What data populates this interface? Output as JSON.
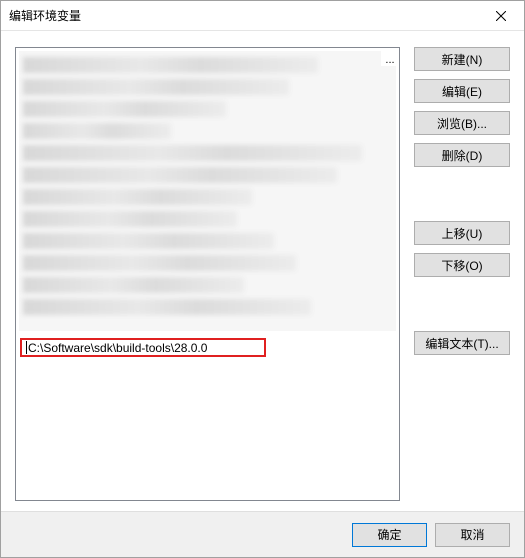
{
  "title": "编辑环境变量",
  "list": {
    "editing_value": "C:\\Software\\sdk\\build-tools\\28.0.0",
    "ellipsis": "..."
  },
  "buttons": {
    "new": "新建(N)",
    "edit": "编辑(E)",
    "browse": "浏览(B)...",
    "delete": "删除(D)",
    "move_up": "上移(U)",
    "move_down": "下移(O)",
    "edit_text": "编辑文本(T)..."
  },
  "footer": {
    "ok": "确定",
    "cancel": "取消"
  }
}
